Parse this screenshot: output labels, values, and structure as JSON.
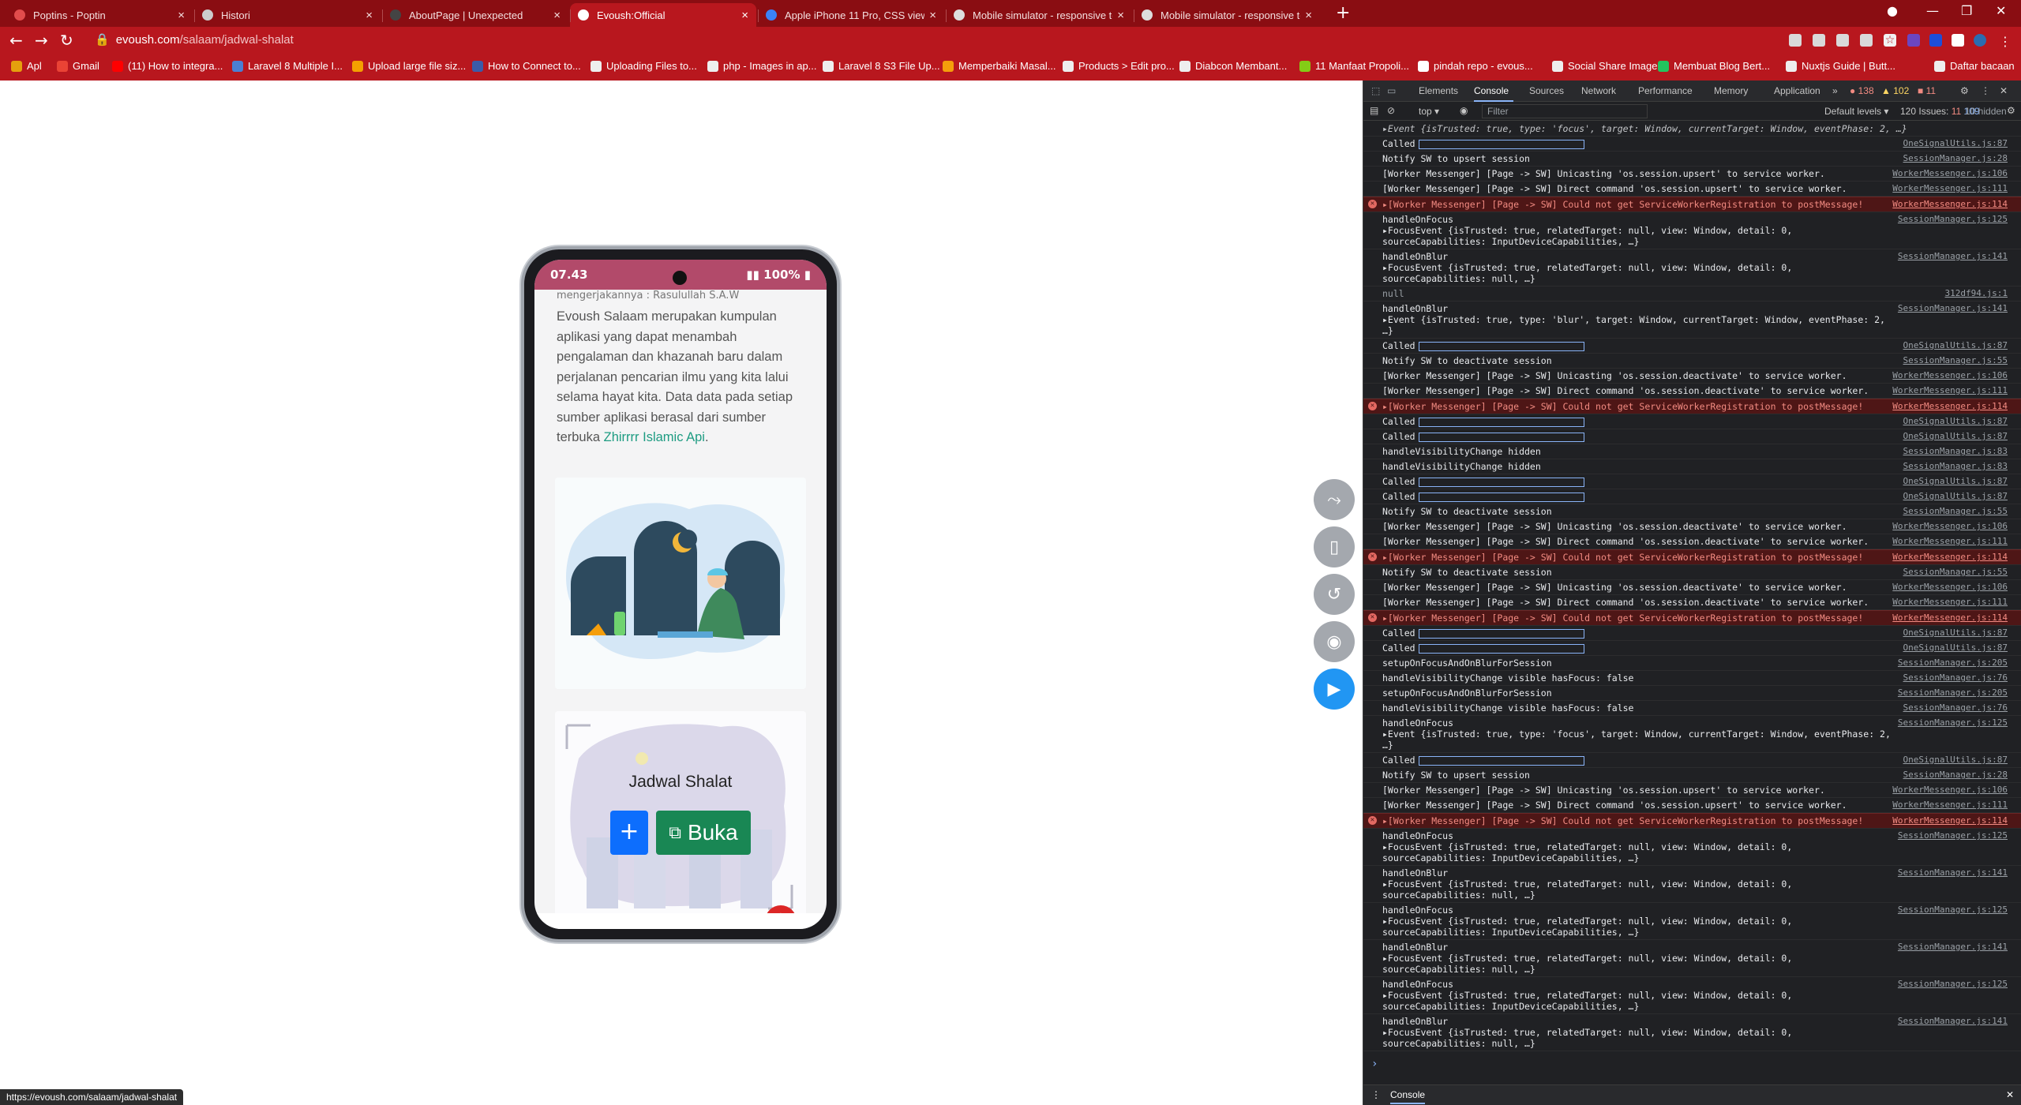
{
  "tabs": [
    {
      "title": "Poptins - Poptin",
      "color": "#e14c4c"
    },
    {
      "title": "Histori",
      "color": "#cccccc"
    },
    {
      "title": "AboutPage | Unexpected",
      "color": "#444444"
    },
    {
      "title": "Evoush:Official",
      "color": "#ffffff",
      "active": true
    },
    {
      "title": "Apple iPhone 11 Pro, CSS viewp",
      "color": "#3b82f6"
    },
    {
      "title": "Mobile simulator - responsive te",
      "color": "#dddddd"
    },
    {
      "title": "Mobile simulator - responsive te",
      "color": "#dddddd"
    }
  ],
  "omnibox": {
    "host": "evoush.com",
    "path": "/salaam/jadwal-shalat"
  },
  "bookmarks": [
    {
      "label": "Apl",
      "color": "#e5a00d"
    },
    {
      "label": "Gmail",
      "color": "#ea4335"
    },
    {
      "label": "(11) How to integra...",
      "color": "#ff0000"
    },
    {
      "label": "Laravel 8 Multiple I...",
      "color": "#4a7fd4"
    },
    {
      "label": "Upload large file siz...",
      "color": "#f4a000"
    },
    {
      "label": "How to Connect to...",
      "color": "#3b5ba9"
    },
    {
      "label": "Uploading Files to...",
      "color": "#eeeeee"
    },
    {
      "label": "php - Images in ap...",
      "color": "#eeeeee"
    },
    {
      "label": "Laravel 8 S3 File Up...",
      "color": "#eeeeee"
    },
    {
      "label": "Memperbaiki Masal...",
      "color": "#f59e0b"
    },
    {
      "label": "Products > Edit pro...",
      "color": "#eeeeee"
    },
    {
      "label": "Diabcon Membant...",
      "color": "#eeeeee"
    },
    {
      "label": "11 Manfaat Propoli...",
      "color": "#84cc16"
    },
    {
      "label": "pindah repo - evous...",
      "color": "#ffffff"
    },
    {
      "label": "Social Share Image...",
      "color": "#eeeeee"
    },
    {
      "label": "Membuat Blog Bert...",
      "color": "#22c55e"
    },
    {
      "label": "Nuxtjs Guide | Butt...",
      "color": "#eeeeee"
    },
    {
      "label": "Daftar bacaan",
      "color": "#eeeeee"
    }
  ],
  "phone": {
    "time": "07.43",
    "battery": "100%",
    "hadits": "mengerjakannya : Rasulullah S.A.W",
    "description": "Evoush Salaam merupakan kumpulan aplikasi yang dapat menambah pengalaman dan khazanah baru dalam perjalanan pencarian ilmu yang kita lalui selama hayat kita. Data data pada setiap sumber aplikasi berasal dari sumber terbuka ",
    "link_text": "Zhirrrr Islamic Api",
    "link_after": ".",
    "card_title": "Jadwal Shalat",
    "plus_label": "+",
    "open_label": "Buka"
  },
  "status_url": "https://evoush.com/salaam/jadwal-shalat",
  "devtools": {
    "tabs": [
      "Elements",
      "Console",
      "Sources",
      "Network",
      "Performance",
      "Memory",
      "Application"
    ],
    "counts": {
      "errors": "138",
      "warnings": "102",
      "messages": "11"
    },
    "context": "top",
    "filter_placeholder": "Filter",
    "levels": "Default levels",
    "issues": "120 Issues:",
    "issue_err": "11",
    "issue_info": "109",
    "hidden": "10 hidden",
    "drawer_tab": "Console",
    "log": [
      {
        "msg": "▸Event {isTrusted: true, type: 'focus', target: Window, currentTarget: Window, eventPhase: 2, …}",
        "src": "",
        "kind": "obj"
      },
      {
        "msg": "Called",
        "src": "OneSignalUtils.js:87",
        "kind": "called"
      },
      {
        "msg": "Notify SW to upsert session",
        "src": "SessionManager.js:28",
        "kind": "log"
      },
      {
        "msg": "[Worker Messenger] [Page -> SW] Unicasting 'os.session.upsert' to service worker.",
        "src": "WorkerMessenger.js:106",
        "kind": "log"
      },
      {
        "msg": "[Worker Messenger] [Page -> SW] Direct command 'os.session.upsert' to service worker.",
        "src": "WorkerMessenger.js:111",
        "kind": "log"
      },
      {
        "msg": "▸[Worker Messenger] [Page -> SW] Could not get ServiceWorkerRegistration to postMessage!",
        "src": "WorkerMessenger.js:114",
        "kind": "err"
      },
      {
        "msg": "handleOnFocus\n▸FocusEvent {isTrusted: true, relatedTarget: null, view: Window, detail: 0, sourceCapabilities: InputDeviceCapabilities, …}",
        "src": "SessionManager.js:125",
        "kind": "log"
      },
      {
        "msg": "handleOnBlur\n▸FocusEvent {isTrusted: true, relatedTarget: null, view: Window, detail: 0, sourceCapabilities: null, …}",
        "src": "SessionManager.js:141",
        "kind": "log"
      },
      {
        "msg": "null",
        "src": "312df94.js:1",
        "kind": "dim"
      },
      {
        "msg": "handleOnBlur\n▸Event {isTrusted: true, type: 'blur', target: Window, currentTarget: Window, eventPhase: 2, …}",
        "src": "SessionManager.js:141",
        "kind": "log"
      },
      {
        "msg": "Called",
        "src": "OneSignalUtils.js:87",
        "kind": "called"
      },
      {
        "msg": "Notify SW to deactivate session",
        "src": "SessionManager.js:55",
        "kind": "log"
      },
      {
        "msg": "[Worker Messenger] [Page -> SW] Unicasting 'os.session.deactivate' to service worker.",
        "src": "WorkerMessenger.js:106",
        "kind": "log"
      },
      {
        "msg": "[Worker Messenger] [Page -> SW] Direct command 'os.session.deactivate' to service worker.",
        "src": "WorkerMessenger.js:111",
        "kind": "log"
      },
      {
        "msg": "▸[Worker Messenger] [Page -> SW] Could not get ServiceWorkerRegistration to postMessage!",
        "src": "WorkerMessenger.js:114",
        "kind": "err"
      },
      {
        "msg": "Called",
        "src": "OneSignalUtils.js:87",
        "kind": "called"
      },
      {
        "msg": "Called",
        "src": "OneSignalUtils.js:87",
        "kind": "called"
      },
      {
        "msg": "handleVisibilityChange hidden",
        "src": "SessionManager.js:83",
        "kind": "log"
      },
      {
        "msg": "handleVisibilityChange hidden",
        "src": "SessionManager.js:83",
        "kind": "log"
      },
      {
        "msg": "Called",
        "src": "OneSignalUtils.js:87",
        "kind": "called"
      },
      {
        "msg": "Called",
        "src": "OneSignalUtils.js:87",
        "kind": "called"
      },
      {
        "msg": "Notify SW to deactivate session",
        "src": "SessionManager.js:55",
        "kind": "log"
      },
      {
        "msg": "[Worker Messenger] [Page -> SW] Unicasting 'os.session.deactivate' to service worker.",
        "src": "WorkerMessenger.js:106",
        "kind": "log"
      },
      {
        "msg": "[Worker Messenger] [Page -> SW] Direct command 'os.session.deactivate' to service worker.",
        "src": "WorkerMessenger.js:111",
        "kind": "log"
      },
      {
        "msg": "▸[Worker Messenger] [Page -> SW] Could not get ServiceWorkerRegistration to postMessage!",
        "src": "WorkerMessenger.js:114",
        "kind": "err"
      },
      {
        "msg": "Notify SW to deactivate session",
        "src": "SessionManager.js:55",
        "kind": "log"
      },
      {
        "msg": "[Worker Messenger] [Page -> SW] Unicasting 'os.session.deactivate' to service worker.",
        "src": "WorkerMessenger.js:106",
        "kind": "log"
      },
      {
        "msg": "[Worker Messenger] [Page -> SW] Direct command 'os.session.deactivate' to service worker.",
        "src": "WorkerMessenger.js:111",
        "kind": "log"
      },
      {
        "msg": "▸[Worker Messenger] [Page -> SW] Could not get ServiceWorkerRegistration to postMessage!",
        "src": "WorkerMessenger.js:114",
        "kind": "err"
      },
      {
        "msg": "Called",
        "src": "OneSignalUtils.js:87",
        "kind": "called"
      },
      {
        "msg": "Called",
        "src": "OneSignalUtils.js:87",
        "kind": "called"
      },
      {
        "msg": "setupOnFocusAndOnBlurForSession",
        "src": "SessionManager.js:205",
        "kind": "log"
      },
      {
        "msg": "handleVisibilityChange visible hasFocus: false",
        "src": "SessionManager.js:76",
        "kind": "log"
      },
      {
        "msg": "setupOnFocusAndOnBlurForSession",
        "src": "SessionManager.js:205",
        "kind": "log"
      },
      {
        "msg": "handleVisibilityChange visible hasFocus: false",
        "src": "SessionManager.js:76",
        "kind": "log"
      },
      {
        "msg": "handleOnFocus\n▸Event {isTrusted: true, type: 'focus', target: Window, currentTarget: Window, eventPhase: 2, …}",
        "src": "SessionManager.js:125",
        "kind": "log"
      },
      {
        "msg": "Called",
        "src": "OneSignalUtils.js:87",
        "kind": "called"
      },
      {
        "msg": "Notify SW to upsert session",
        "src": "SessionManager.js:28",
        "kind": "log"
      },
      {
        "msg": "[Worker Messenger] [Page -> SW] Unicasting 'os.session.upsert' to service worker.",
        "src": "WorkerMessenger.js:106",
        "kind": "log"
      },
      {
        "msg": "[Worker Messenger] [Page -> SW] Direct command 'os.session.upsert' to service worker.",
        "src": "WorkerMessenger.js:111",
        "kind": "log"
      },
      {
        "msg": "▸[Worker Messenger] [Page -> SW] Could not get ServiceWorkerRegistration to postMessage!",
        "src": "WorkerMessenger.js:114",
        "kind": "err"
      },
      {
        "msg": "handleOnFocus\n▸FocusEvent {isTrusted: true, relatedTarget: null, view: Window, detail: 0, sourceCapabilities: InputDeviceCapabilities, …}",
        "src": "SessionManager.js:125",
        "kind": "log"
      },
      {
        "msg": "handleOnBlur\n▸FocusEvent {isTrusted: true, relatedTarget: null, view: Window, detail: 0, sourceCapabilities: null, …}",
        "src": "SessionManager.js:141",
        "kind": "log"
      },
      {
        "msg": "handleOnFocus\n▸FocusEvent {isTrusted: true, relatedTarget: null, view: Window, detail: 0, sourceCapabilities: InputDeviceCapabilities, …}",
        "src": "SessionManager.js:125",
        "kind": "log"
      },
      {
        "msg": "handleOnBlur\n▸FocusEvent {isTrusted: true, relatedTarget: null, view: Window, detail: 0, sourceCapabilities: null, …}",
        "src": "SessionManager.js:141",
        "kind": "log"
      },
      {
        "msg": "handleOnFocus\n▸FocusEvent {isTrusted: true, relatedTarget: null, view: Window, detail: 0, sourceCapabilities: InputDeviceCapabilities, …}",
        "src": "SessionManager.js:125",
        "kind": "log"
      },
      {
        "msg": "handleOnBlur\n▸FocusEvent {isTrusted: true, relatedTarget: null, view: Window, detail: 0, sourceCapabilities: null, …}",
        "src": "SessionManager.js:141",
        "kind": "log"
      }
    ]
  },
  "colors": {
    "chrome_accent": "#b8171e",
    "tabstrip": "#8a0d12",
    "status_bar_phone": "#b24a6a",
    "link_green": "#1e9c82",
    "btn_blue": "#0d6efd",
    "btn_green": "#198754",
    "fab_gray": "#9aa0a6",
    "fab_blue": "#2196f3"
  }
}
